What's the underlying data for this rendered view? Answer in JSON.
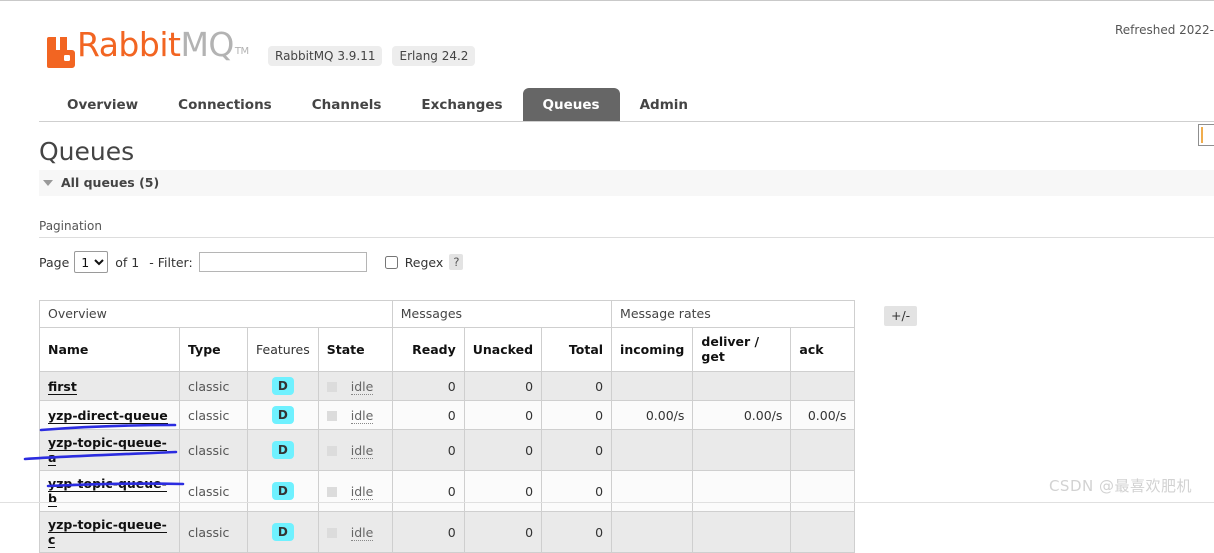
{
  "header": {
    "logo": {
      "rabbit": "Rabbit",
      "mq": "MQ",
      "tm": "TM"
    },
    "badges": [
      {
        "label": "RabbitMQ 3.9.11"
      },
      {
        "label": "Erlang 24.2"
      }
    ],
    "refreshed": "Refreshed 2022-"
  },
  "nav": {
    "tabs": [
      {
        "label": "Overview",
        "active": false
      },
      {
        "label": "Connections",
        "active": false
      },
      {
        "label": "Channels",
        "active": false
      },
      {
        "label": "Exchanges",
        "active": false
      },
      {
        "label": "Queues",
        "active": true
      },
      {
        "label": "Admin",
        "active": false
      }
    ]
  },
  "main": {
    "title": "Queues",
    "section_heading": "All queues (5)",
    "pagination_label": "Pagination",
    "pagination": {
      "page_label": "Page",
      "page_value": "1",
      "page_options": [
        "1"
      ],
      "of_label": "of 1",
      "filter_label": "- Filter:",
      "filter_value": "",
      "filter_placeholder": "",
      "regex_label": "Regex",
      "regex_checked": false,
      "help_label": "?"
    },
    "table": {
      "group_headers": [
        {
          "label": "Overview",
          "span": 4
        },
        {
          "label": "Messages",
          "span": 3
        },
        {
          "label": "Message rates",
          "span": 3
        }
      ],
      "columns": [
        {
          "label": "Name",
          "style": "sortable"
        },
        {
          "label": "Type",
          "style": "sortable"
        },
        {
          "label": "Features",
          "style": "plain"
        },
        {
          "label": "State",
          "style": "sortable"
        },
        {
          "label": "Ready",
          "style": "num"
        },
        {
          "label": "Unacked",
          "style": "num"
        },
        {
          "label": "Total",
          "style": "num"
        },
        {
          "label": "incoming",
          "style": "rate"
        },
        {
          "label": "deliver / get",
          "style": "rate"
        },
        {
          "label": "ack",
          "style": "rate"
        }
      ],
      "toggle_columns_label": "+/-",
      "rows": [
        {
          "name": "first",
          "type": "classic",
          "features": "D",
          "state": "idle",
          "ready": "0",
          "unacked": "0",
          "total": "0",
          "incoming": "",
          "deliver_get": "",
          "ack": ""
        },
        {
          "name": "yzp-direct-queue",
          "type": "classic",
          "features": "D",
          "state": "idle",
          "ready": "0",
          "unacked": "0",
          "total": "0",
          "incoming": "0.00/s",
          "deliver_get": "0.00/s",
          "ack": "0.00/s"
        },
        {
          "name": "yzp-topic-queue-a",
          "type": "classic",
          "features": "D",
          "state": "idle",
          "ready": "0",
          "unacked": "0",
          "total": "0",
          "incoming": "",
          "deliver_get": "",
          "ack": ""
        },
        {
          "name": "yzp-topic-queue-b",
          "type": "classic",
          "features": "D",
          "state": "idle",
          "ready": "0",
          "unacked": "0",
          "total": "0",
          "incoming": "",
          "deliver_get": "",
          "ack": ""
        },
        {
          "name": "yzp-topic-queue-c",
          "type": "classic",
          "features": "D",
          "state": "idle",
          "ready": "0",
          "unacked": "0",
          "total": "0",
          "incoming": "",
          "deliver_get": "",
          "ack": ""
        }
      ]
    }
  },
  "watermark": "CSDN @最喜欢肥机",
  "colors": {
    "brand_orange": "#f26522",
    "logo_gray": "#b3b3b3",
    "active_tab_bg": "#666666",
    "durable_badge": "#6ff1ff",
    "annotation_blue": "#2b2ce0",
    "row_odd": "#eaeaea",
    "row_even": "#fbfbfb"
  }
}
